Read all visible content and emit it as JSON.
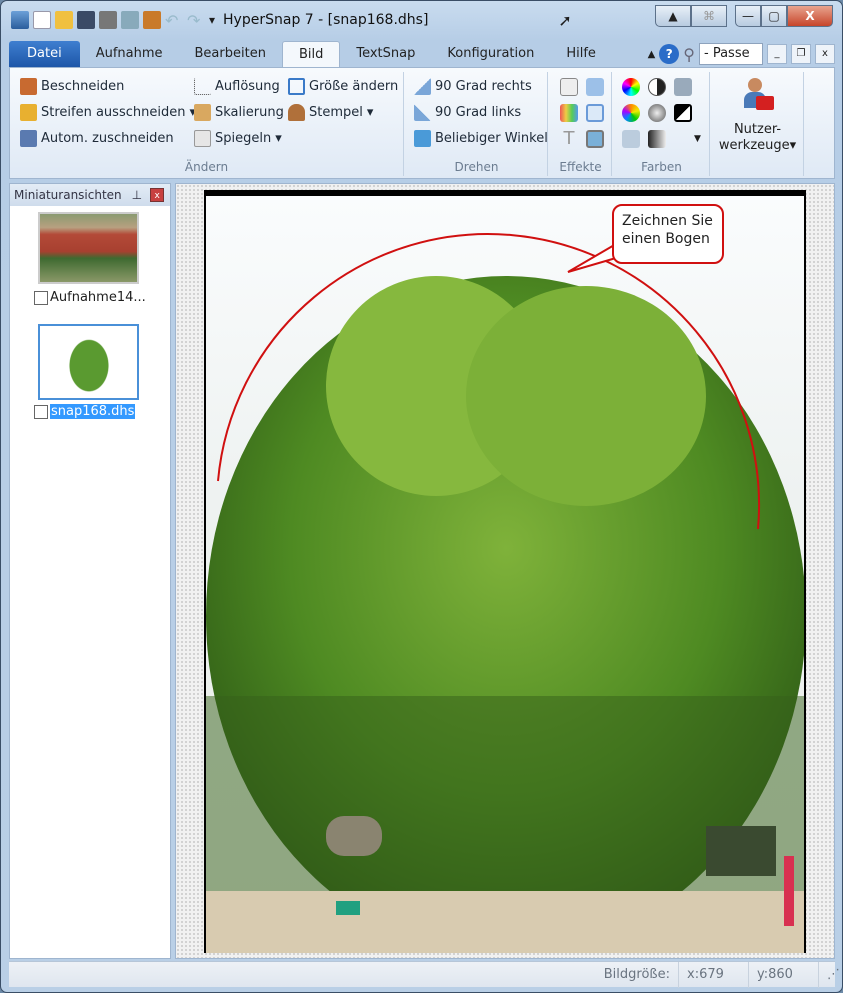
{
  "window": {
    "title": "HyperSnap 7 - [snap168.dhs]"
  },
  "tabs": [
    {
      "label": "Datei"
    },
    {
      "label": "Aufnahme"
    },
    {
      "label": "Bearbeiten"
    },
    {
      "label": "Bild"
    },
    {
      "label": "TextSnap"
    },
    {
      "label": "Konfiguration"
    },
    {
      "label": "Hilfe"
    }
  ],
  "active_tab": "Bild",
  "zoom_combo": "- Passe",
  "ribbon": {
    "aendern": {
      "label": "Ändern",
      "items": [
        "Beschneiden",
        "Streifen ausschneiden",
        "Autom. zuschneiden",
        "Auflösung",
        "Skalierung",
        "Spiegeln",
        "Größe ändern",
        "Stempel"
      ]
    },
    "drehen": {
      "label": "Drehen",
      "items": [
        "90 Grad rechts",
        "90 Grad links",
        "Beliebiger Winkel"
      ]
    },
    "effekte": {
      "label": "Effekte"
    },
    "farben": {
      "label": "Farben"
    },
    "nutzer": {
      "line1": "Nutzer-",
      "line2": "werkzeuge"
    }
  },
  "panel": {
    "title": "Miniaturansichten",
    "thumbs": [
      {
        "label": "Aufnahme14..."
      },
      {
        "label": "snap168.dhs",
        "selected": true
      }
    ]
  },
  "callout": {
    "line1": "Zeichnen Sie",
    "line2": "einen Bogen"
  },
  "colors": {
    "arc": "#d01010",
    "selection": "#3399ff"
  },
  "status": {
    "label": "Bildgröße:",
    "x": "x:679",
    "y": "y:860"
  }
}
